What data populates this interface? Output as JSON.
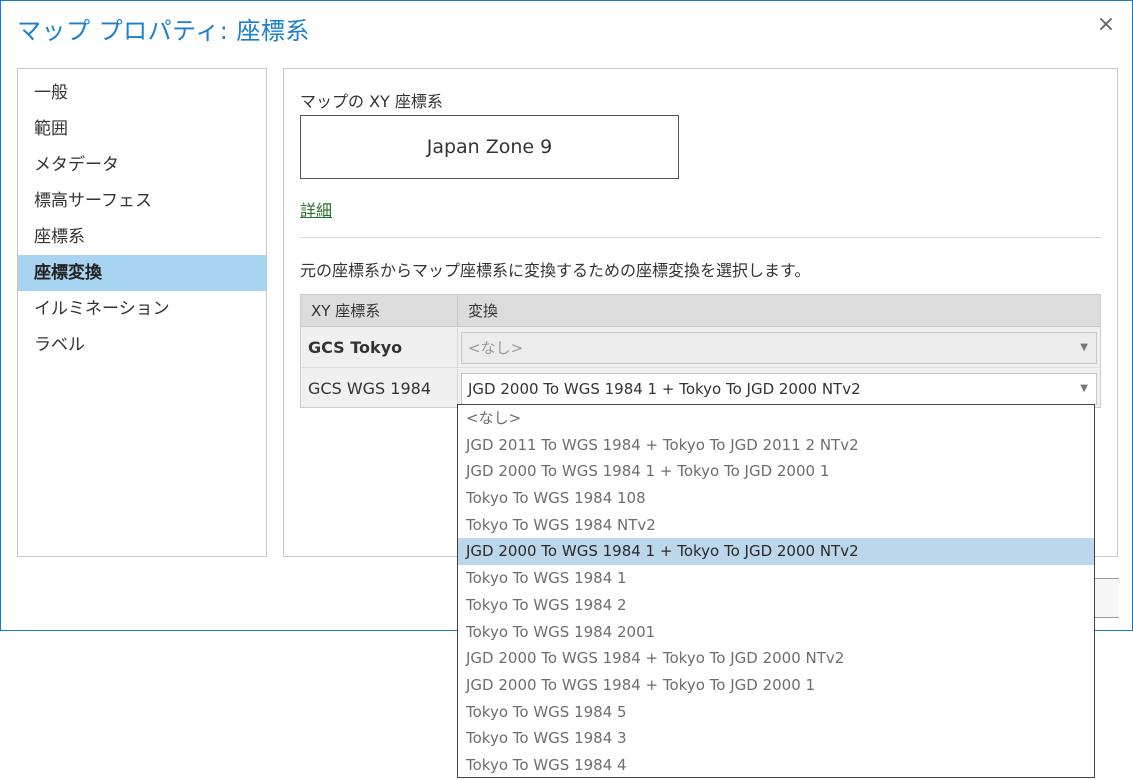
{
  "dialog": {
    "title": "マップ プロパティ: 座標系",
    "close_label": "×"
  },
  "nav": {
    "items": [
      {
        "label": "一般"
      },
      {
        "label": "範囲"
      },
      {
        "label": "メタデータ"
      },
      {
        "label": "標高サーフェス"
      },
      {
        "label": "座標系"
      },
      {
        "label": "座標変換"
      },
      {
        "label": "イルミネーション"
      },
      {
        "label": "ラベル"
      }
    ],
    "selected": "座標変換"
  },
  "content": {
    "section_label": "マップの XY 座標系",
    "current_cs": "Japan Zone 9",
    "detail_link": "詳細",
    "instruction": "元の座標系からマップ座標系に変換するための座標変換を選択します。",
    "grid": {
      "headers": [
        "XY 座標系",
        "変換"
      ],
      "rows": [
        {
          "label": "GCS Tokyo",
          "value": "<なし>",
          "disabled": true
        },
        {
          "label": "GCS WGS 1984",
          "value": "JGD 2000 To WGS 1984 1 + Tokyo To JGD 2000 NTv2",
          "disabled": false
        }
      ]
    },
    "dropdown_arrow": "▼"
  },
  "dropdown_list": {
    "options": [
      "<なし>",
      "JGD 2011 To WGS 1984 + Tokyo To JGD 2011 2 NTv2",
      "JGD 2000 To WGS 1984 1 + Tokyo To JGD 2000 1",
      "Tokyo To WGS 1984 108",
      "Tokyo To WGS 1984 NTv2",
      "JGD 2000 To WGS 1984 1 + Tokyo To JGD 2000 NTv2",
      "Tokyo To WGS 1984 1",
      "Tokyo To WGS 1984 2",
      "Tokyo To WGS 1984 2001",
      "JGD 2000 To WGS 1984 + Tokyo To JGD 2000 NTv2",
      "JGD 2000 To WGS 1984 + Tokyo To JGD 2000 1",
      "Tokyo To WGS 1984 5",
      "Tokyo To WGS 1984 3",
      "Tokyo To WGS 1984 4"
    ],
    "highlighted": "JGD 2000 To WGS 1984 1 + Tokyo To JGD 2000 NTv2"
  },
  "colors": {
    "title": "#1a7fd0",
    "selection": "#a7d4f0",
    "highlight": "#bcd6ec",
    "underline": "#e02020"
  }
}
